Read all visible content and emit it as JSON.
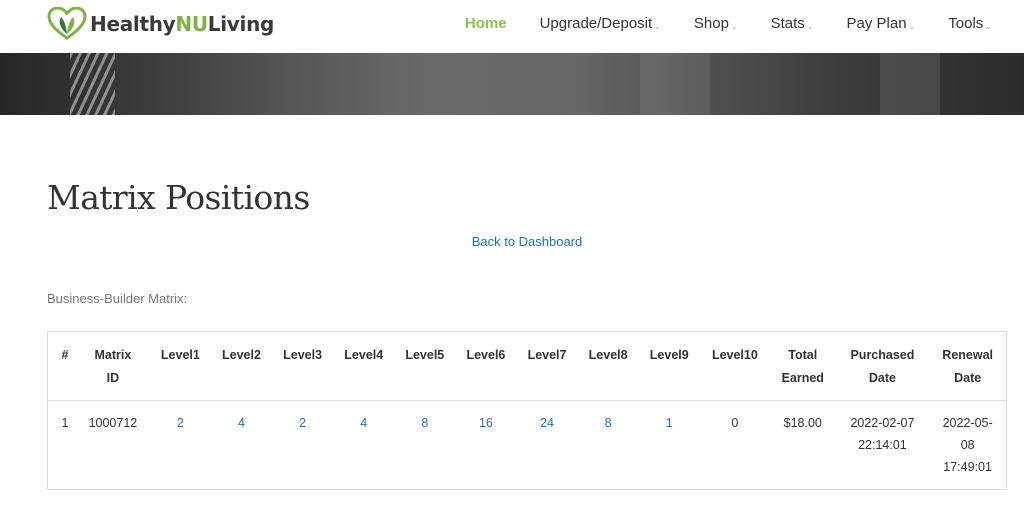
{
  "header": {
    "logo": {
      "prefix": "Healthy",
      "highlight": "NU",
      "suffix": "Living"
    },
    "nav": [
      {
        "label": "Home",
        "active": true,
        "dropdown": false
      },
      {
        "label": "Upgrade/Deposit",
        "active": false,
        "dropdown": true
      },
      {
        "label": "Shop",
        "active": false,
        "dropdown": true
      },
      {
        "label": "Stats",
        "active": false,
        "dropdown": true
      },
      {
        "label": "Pay Plan",
        "active": false,
        "dropdown": true
      },
      {
        "label": "Tools",
        "active": false,
        "dropdown": true
      }
    ]
  },
  "page": {
    "title": "Matrix Positions",
    "back_link": "Back to Dashboard",
    "section_label": "Business-Builder Matrix:"
  },
  "table": {
    "headers": {
      "num": "#",
      "matrix_id_1": "Matrix",
      "matrix_id_2": "ID",
      "l1": "Level1",
      "l2": "Level2",
      "l3": "Level3",
      "l4": "Level4",
      "l5": "Level5",
      "l6": "Level6",
      "l7": "Level7",
      "l8": "Level8",
      "l9": "Level9",
      "l10": "Level10",
      "total_1": "Total",
      "total_2": "Earned",
      "purchased_1": "Purchased",
      "purchased_2": "Date",
      "renewal_1": "Renewal",
      "renewal_2": "Date"
    },
    "rows": [
      {
        "num": "1",
        "matrix_id": "1000712",
        "levels": [
          "2",
          "4",
          "2",
          "4",
          "8",
          "16",
          "24",
          "8",
          "1",
          "0"
        ],
        "total_earned": "$18.00",
        "purchased_date": "2022-02-07",
        "purchased_time": "22:14:01",
        "renewal_line1": "2022-05-",
        "renewal_line2": "08",
        "renewal_time": "17:49:01"
      }
    ]
  },
  "colors": {
    "accent": "#8bc34a",
    "link": "#1f6ebd"
  }
}
